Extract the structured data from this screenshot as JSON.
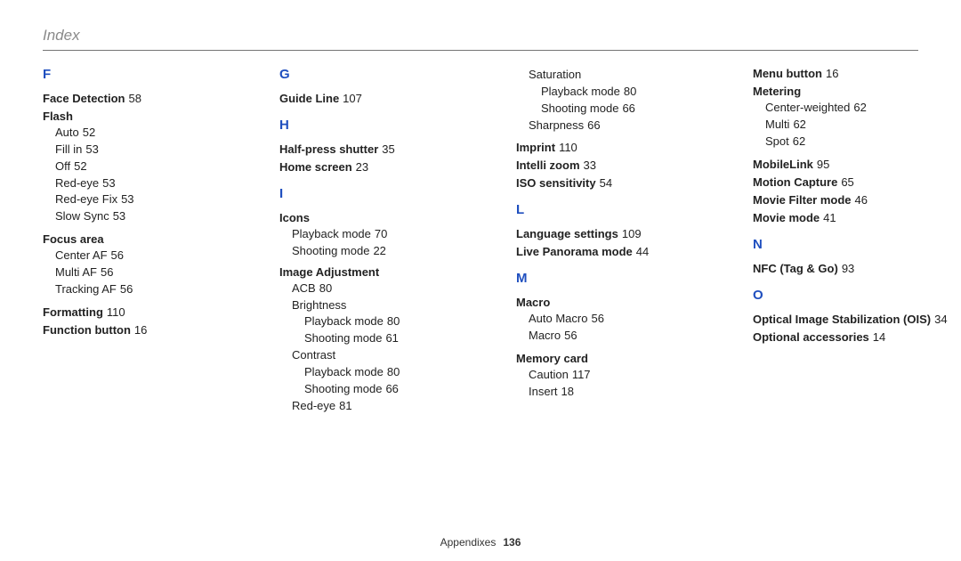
{
  "page": {
    "title": "Index",
    "footer_section": "Appendixes",
    "footer_page": "136"
  },
  "col1": {
    "F": "F",
    "face_detection": "Face Detection",
    "face_detection_p": "58",
    "flash": "Flash",
    "flash_auto": "Auto",
    "flash_auto_p": "52",
    "flash_fillin": "Fill in",
    "flash_fillin_p": "53",
    "flash_off": "Off",
    "flash_off_p": "52",
    "flash_redeye": "Red-eye",
    "flash_redeye_p": "53",
    "flash_redeyefix": "Red-eye Fix",
    "flash_redeyefix_p": "53",
    "flash_slowsync": "Slow Sync",
    "flash_slowsync_p": "53",
    "focus_area": "Focus area",
    "fa_center": "Center AF",
    "fa_center_p": "56",
    "fa_multi": "Multi AF",
    "fa_multi_p": "56",
    "fa_track": "Tracking AF",
    "fa_track_p": "56",
    "formatting": "Formatting",
    "formatting_p": "110",
    "function_button": "Function button",
    "function_button_p": "16"
  },
  "col2": {
    "G": "G",
    "guide_line": "Guide Line",
    "guide_line_p": "107",
    "H": "H",
    "half_press": "Half-press shutter",
    "half_press_p": "35",
    "home_screen": "Home screen",
    "home_screen_p": "23",
    "I": "I",
    "icons": "Icons",
    "icons_pb": "Playback mode",
    "icons_pb_p": "70",
    "icons_sh": "Shooting mode",
    "icons_sh_p": "22",
    "image_adj": "Image Adjustment",
    "ia_acb": "ACB",
    "ia_acb_p": "80",
    "ia_brightness": "Brightness",
    "ia_br_pb": "Playback mode",
    "ia_br_pb_p": "80",
    "ia_br_sh": "Shooting mode",
    "ia_br_sh_p": "61",
    "ia_contrast": "Contrast",
    "ia_ct_pb": "Playback mode",
    "ia_ct_pb_p": "80",
    "ia_ct_sh": "Shooting mode",
    "ia_ct_sh_p": "66",
    "ia_redeye": "Red-eye",
    "ia_redeye_p": "81"
  },
  "col3": {
    "ia_saturation": "Saturation",
    "ia_sa_pb": "Playback mode",
    "ia_sa_pb_p": "80",
    "ia_sa_sh": "Shooting mode",
    "ia_sa_sh_p": "66",
    "ia_sharpness": "Sharpness",
    "ia_sharpness_p": "66",
    "imprint": "Imprint",
    "imprint_p": "110",
    "intelli_zoom": "Intelli zoom",
    "intelli_zoom_p": "33",
    "iso": "ISO sensitivity",
    "iso_p": "54",
    "L": "L",
    "lang": "Language settings",
    "lang_p": "109",
    "live_pano": "Live Panorama mode",
    "live_pano_p": "44",
    "M": "M",
    "macro": "Macro",
    "macro_auto": "Auto Macro",
    "macro_auto_p": "56",
    "macro_macro": "Macro",
    "macro_macro_p": "56",
    "memory_card": "Memory card",
    "mc_caution": "Caution",
    "mc_caution_p": "117",
    "mc_insert": "Insert",
    "mc_insert_p": "18"
  },
  "col4": {
    "menu_button": "Menu button",
    "menu_button_p": "16",
    "metering": "Metering",
    "met_center": "Center-weighted",
    "met_center_p": "62",
    "met_multi": "Multi",
    "met_multi_p": "62",
    "met_spot": "Spot",
    "met_spot_p": "62",
    "mobilelink": "MobileLink",
    "mobilelink_p": "95",
    "motion_capture": "Motion Capture",
    "motion_capture_p": "65",
    "movie_filter": "Movie Filter mode",
    "movie_filter_p": "46",
    "movie_mode": "Movie mode",
    "movie_mode_p": "41",
    "N": "N",
    "nfc": "NFC (Tag & Go)",
    "nfc_p": "93",
    "O": "O",
    "ois": "Optical Image Stabilization (OIS)",
    "ois_p": "34",
    "opt_acc": "Optional accessories",
    "opt_acc_p": "14"
  }
}
